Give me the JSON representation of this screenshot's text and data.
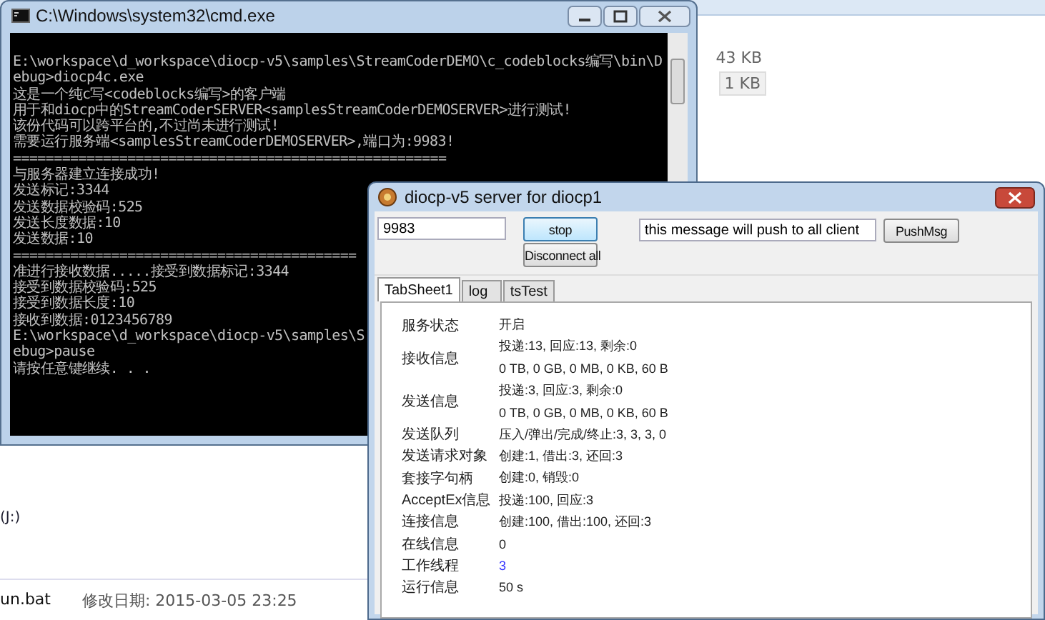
{
  "explorer": {
    "sizes": [
      {
        "text": "43 KB",
        "selected": false
      },
      {
        "text": "1 KB",
        "selected": true
      }
    ],
    "nav_items": [
      "(J:)"
    ],
    "file": {
      "name": "un.bat",
      "modified": "修改日期: 2015-03-05 23:25"
    }
  },
  "console_window": {
    "title": "C:\\Windows\\system32\\cmd.exe",
    "lines": [
      "E:\\workspace\\d_workspace\\diocp-v5\\samples\\StreamCoderDEMO\\c_codeblocks编写\\bin\\D",
      "ebug>diocp4c.exe",
      "这是一个纯c写<codeblocks编写>的客户端",
      "用于和diocp中的StreamCoderSERVER<samplesStreamCoderDEMOSERVER>进行测试!",
      "该份代码可以跨平台的,不过尚未进行测试!",
      "需要运行服务端<samplesStreamCoderDEMOSERVER>,端口为:9983!",
      "=====================================================",
      "与服务器建立连接成功!",
      "发送标记:3344",
      "发送数据校验码:525",
      "发送长度数据:10",
      "发送数据:10",
      "==========================================",
      "准进行接收数据.....接受到数据标记:3344",
      "接受到数据校验码:525",
      "接受到数据长度:10",
      "接收到数据:0123456789",
      "E:\\workspace\\d_workspace\\diocp-v5\\samples\\S",
      "ebug>pause",
      "请按任意键继续. . ."
    ]
  },
  "server_window": {
    "title": "diocp-v5 server for diocp1",
    "port": "9983",
    "stop_button": "stop",
    "disconnect_button": "Disconnect all",
    "message": "this message will push to all client",
    "push_button": "PushMsg",
    "tabs": [
      {
        "label": "TabSheet1",
        "selected": true
      },
      {
        "label": "log",
        "selected": false
      },
      {
        "label": "tsTest",
        "selected": false
      }
    ],
    "rows": [
      {
        "label": "服务状态",
        "values": [
          "开启"
        ]
      },
      {
        "label": "接收信息",
        "values": [
          "投递:13, 回应:13, 剩余:0",
          "0 TB, 0 GB, 0 MB, 0 KB, 60 B"
        ]
      },
      {
        "label": "发送信息",
        "values": [
          "投递:3, 回应:3, 剩余:0",
          "0 TB, 0 GB, 0 MB, 0 KB, 60 B"
        ]
      },
      {
        "label": "发送队列",
        "values": [
          "压入/弹出/完成/终止:3, 3, 3, 0"
        ]
      },
      {
        "label": "发送请求对象",
        "values": [
          "创建:1, 借出:3, 还回:3"
        ]
      },
      {
        "label": "套接字句柄",
        "values": [
          "创建:0, 销毁:0"
        ]
      },
      {
        "label": "AcceptEx信息",
        "values": [
          "投递:100, 回应:3"
        ]
      },
      {
        "label": "连接信息",
        "values": [
          "创建:100, 借出:100, 还回:3"
        ]
      },
      {
        "label": "在线信息",
        "values": [
          "0"
        ]
      },
      {
        "label": "工作线程",
        "values": [
          "3"
        ],
        "color": "#3333ff"
      },
      {
        "label": "运行信息",
        "values": [
          "50 s"
        ]
      }
    ]
  }
}
